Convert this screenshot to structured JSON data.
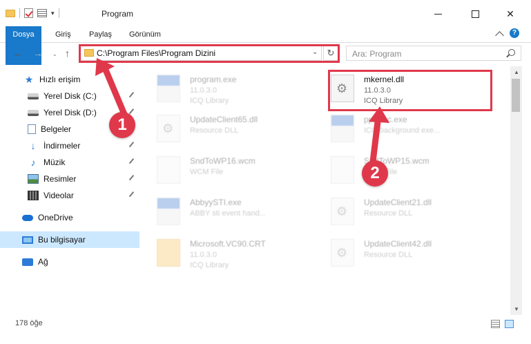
{
  "window": {
    "title": "Program",
    "minimize_label": "",
    "maximize_label": "",
    "close_label": "✕"
  },
  "ribbon": {
    "tabs": [
      "Dosya",
      "Giriş",
      "Paylaş",
      "Görünüm"
    ],
    "help_label": "?"
  },
  "navigation": {
    "back": "←",
    "forward": "→",
    "recent": "⌄",
    "up": "↑",
    "address": "C:\\Program Files\\Program Dizini",
    "address_dropdown": "⌄",
    "refresh": "↻",
    "search_placeholder": "Ara: Program"
  },
  "sidebar": {
    "items": [
      {
        "label": "Hızlı erişim",
        "icon": "star-icon",
        "pinned": false
      },
      {
        "label": "Yerel Disk (C:)",
        "icon": "drive-icon",
        "pinned": true
      },
      {
        "label": "Yerel Disk (D:)",
        "icon": "drive-icon",
        "pinned": true
      },
      {
        "label": "Belgeler",
        "icon": "document-icon",
        "pinned": true
      },
      {
        "label": "İndirmeler",
        "icon": "download-icon",
        "pinned": true
      },
      {
        "label": "Müzik",
        "icon": "music-icon",
        "pinned": true
      },
      {
        "label": "Resimler",
        "icon": "pictures-icon",
        "pinned": true
      },
      {
        "label": "Videolar",
        "icon": "videos-icon",
        "pinned": true
      },
      {
        "label": "OneDrive",
        "icon": "onedrive-icon",
        "pinned": false
      },
      {
        "label": "Bu bilgisayar",
        "icon": "computer-icon",
        "pinned": false,
        "selected": true
      },
      {
        "label": "Ağ",
        "icon": "network-icon",
        "pinned": false
      }
    ]
  },
  "files": [
    {
      "name": "program.exe",
      "line2": "11.0.3.0",
      "line3": "ICQ Library",
      "icon": "exe-icon",
      "highlighted": false
    },
    {
      "name": "mkernel.dll",
      "line2": "11.0.3.0",
      "line3": "ICQ Library",
      "icon": "dll-gear-icon",
      "highlighted": true
    },
    {
      "name": "UpdateClient65.dll",
      "line2": "Resource DLL",
      "line3": "",
      "icon": "dll-gear-icon",
      "highlighted": false
    },
    {
      "name": "ppExec.exe",
      "line2": "ICQ background exe...",
      "line3": "",
      "icon": "app-icon",
      "highlighted": false
    },
    {
      "name": "SndToWP16.wcm",
      "line2": "WCM File",
      "line3": "",
      "icon": "file-icon",
      "highlighted": false
    },
    {
      "name": "SndToWP15.wcm",
      "line2": "WCM File",
      "line3": "",
      "icon": "file-icon",
      "highlighted": false
    },
    {
      "name": "AbbyySTI.exe",
      "line2": "ABBY sti event hand...",
      "line3": "",
      "icon": "app-icon",
      "highlighted": false
    },
    {
      "name": "UpdateClient21.dll",
      "line2": "Resource DLL",
      "line3": "",
      "icon": "dll-gear-icon",
      "highlighted": false
    },
    {
      "name": "Microsoft.VC90.CRT",
      "line2": "11.0.3.0",
      "line3": "ICQ Library",
      "icon": "folder-icon",
      "highlighted": false
    },
    {
      "name": "UpdateClient42.dll",
      "line2": "Resource DLL",
      "line3": "",
      "icon": "dll-gear-icon",
      "highlighted": false
    }
  ],
  "status": {
    "item_count": "178 öğe"
  },
  "callouts": [
    "1",
    "2"
  ],
  "colors": {
    "accent": "#1979ca",
    "highlight_red": "#e0384b",
    "selected_bg": "#cce8ff"
  }
}
